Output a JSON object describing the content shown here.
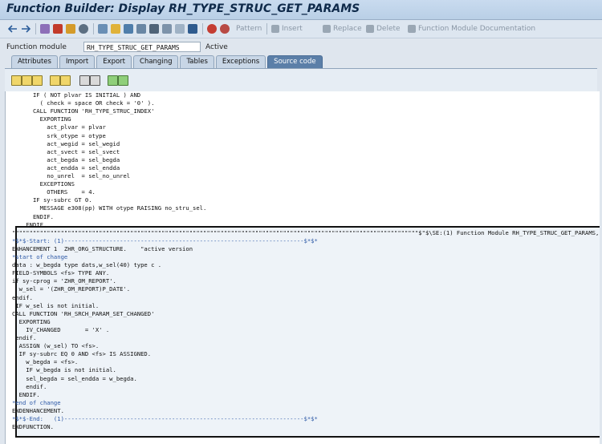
{
  "window": {
    "title": "Function Builder: Display RH_TYPE_STRUC_GET_PARAMS"
  },
  "toolbar": {
    "icons": [
      "back-arrow-icon",
      "forward-arrow-icon",
      "other-object-icon",
      "check-icon",
      "activate-icon",
      "display-change-icon",
      "where-used-icon",
      "object-list-icon",
      "navigation-icon",
      "hierarchy-icon",
      "save-icon",
      "display-object-icon",
      "info-icon",
      "test-icon",
      "breakpoint-icon"
    ],
    "pattern_label": "Pattern",
    "insert_label": "Insert",
    "replace_label": "Replace",
    "delete_label": "Delete",
    "docs_label": "Function Module Documentation"
  },
  "function_module": {
    "label": "Function module",
    "value": "RH_TYPE_STRUC_GET_PARAMS",
    "status": "Active"
  },
  "tabs": [
    {
      "label": "Attributes",
      "active": false
    },
    {
      "label": "Import",
      "active": false
    },
    {
      "label": "Export",
      "active": false
    },
    {
      "label": "Changing",
      "active": false
    },
    {
      "label": "Tables",
      "active": false
    },
    {
      "label": "Exceptions",
      "active": false
    },
    {
      "label": "Source code",
      "active": true
    }
  ],
  "editor_buttons": [
    "cut-icon",
    "copy-icon",
    "paste-icon",
    "undo-icon",
    "redo-icon",
    "find-icon",
    "find-next-icon",
    "insert-statement-icon",
    "pretty-printer-icon"
  ],
  "code_lines": [
    {
      "text": "      IF ( NOT plvar IS INITIAL ) AND",
      "comment": false
    },
    {
      "text": "        ( check = space OR check = '0' ).",
      "comment": false
    },
    {
      "text": "      CALL FUNCTION 'RH_TYPE_STRUC_INDEX'",
      "comment": false
    },
    {
      "text": "        EXPORTING",
      "comment": false
    },
    {
      "text": "          act_plvar = plvar",
      "comment": false
    },
    {
      "text": "          srk_otype = otype",
      "comment": false
    },
    {
      "text": "          act_wegid = sel_wegid",
      "comment": false
    },
    {
      "text": "          act_svect = sel_svect",
      "comment": false
    },
    {
      "text": "          act_begda = sel_begda",
      "comment": false
    },
    {
      "text": "          act_endda = sel_endda",
      "comment": false
    },
    {
      "text": "          no_unrel  = sel_no_unrel",
      "comment": false
    },
    {
      "text": "        EXCEPTIONS",
      "comment": false
    },
    {
      "text": "          OTHERS    = 4.",
      "comment": false
    },
    {
      "text": "      IF sy-subrc GT 0.",
      "comment": false
    },
    {
      "text": "        MESSAGE e308(pp) WITH otype RAISING no_stru_sel.",
      "comment": false
    },
    {
      "text": "      ENDIF.",
      "comment": false
    },
    {
      "text": "    ENDIF.",
      "comment": false
    },
    {
      "text": "\"\"\"\"\"\"\"\"\"\"\"\"\"\"\"\"\"\"\"\"\"\"\"\"\"\"\"\"\"\"\"\"\"\"\"\"\"\"\"\"\"\"\"\"\"\"\"\"\"\"\"\"\"\"\"\"\"\"\"\"\"\"\"\"\"\"\"\"\"\"\"\"\"\"\"\"\"\"\"\"\"\"\"\"\"\"\"\"\"\"\"\"\"\"\"\"\"\"\"\"\"\"\"\"\"\"\"\"\"\"\"\"\"\"\"\"\"$\"$\\SE:(1) Function Module RH_TYPE_STRUC_GET_PARAMS, End",
      "comment": false
    },
    {
      "text": "*$*$-Start: (1)---------------------------------------------------------------------$*$*",
      "comment": true
    },
    {
      "text": "ENHANCEMENT 1  ZHR_ORG_STRUCTURE.    \"active version",
      "comment": false
    },
    {
      "text": "*start of change",
      "comment": true
    },
    {
      "text": "data : w_begda type dats,w_sel(40) type c .",
      "comment": false
    },
    {
      "text": "FIELD-SYMBOLS <fs> TYPE ANY.",
      "comment": false
    },
    {
      "text": "if sy-cprog = 'ZHR_OM_REPORT'.",
      "comment": false
    },
    {
      "text": "  w_sel = '(ZHR_OM_REPORT)P_DATE'.",
      "comment": false
    },
    {
      "text": "endif.",
      "comment": false
    },
    {
      "text": " IF w_sel is not initial.",
      "comment": false
    },
    {
      "text": "CALL FUNCTION 'RH_SRCH_PARAM_SET_CHANGED'",
      "comment": false
    },
    {
      "text": "  EXPORTING",
      "comment": false
    },
    {
      "text": "    IV_CHANGED       = 'X' .",
      "comment": false
    },
    {
      "text": " endif.",
      "comment": false
    },
    {
      "text": "  ASSIGN (w_sel) TO <fs>.",
      "comment": false
    },
    {
      "text": "  IF sy-subrc EQ 0 AND <fs> IS ASSIGNED.",
      "comment": false
    },
    {
      "text": "    w_begda = <fs>.",
      "comment": false
    },
    {
      "text": "    IF w_begda is not initial.",
      "comment": false
    },
    {
      "text": "    sel_begda = sel_endda = w_begda.",
      "comment": false
    },
    {
      "text": "    endif.",
      "comment": false
    },
    {
      "text": "  ENDIF.",
      "comment": false
    },
    {
      "text": "*end of change",
      "comment": true
    },
    {
      "text": "ENDENHANCEMENT.",
      "comment": false
    },
    {
      "text": "*$*$-End:   (1)---------------------------------------------------------------------$*$*",
      "comment": true
    },
    {
      "text": "ENDFUNCTION.",
      "comment": false
    }
  ],
  "colors": {
    "comment": "#2c58a6",
    "active_tab": "#5b7fa8",
    "enhancement_border": "#111111"
  }
}
